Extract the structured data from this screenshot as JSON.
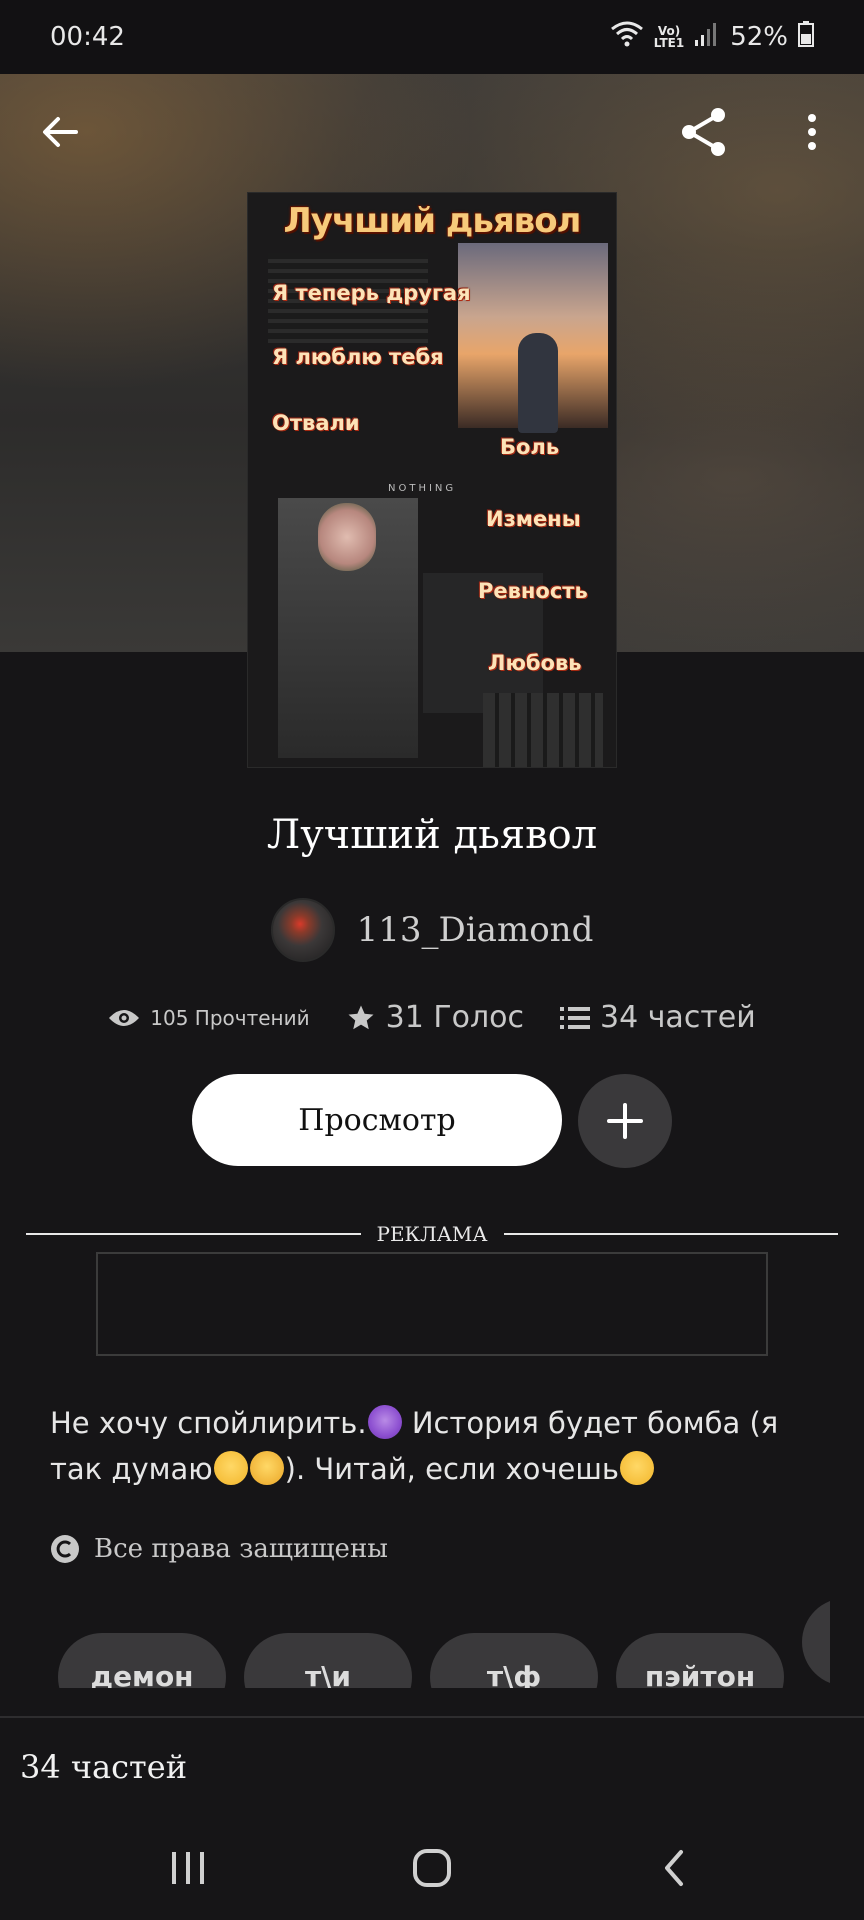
{
  "status_bar": {
    "time": "00:42",
    "lte_top": "Vo)",
    "lte_bottom": "LTE1",
    "battery": "52%"
  },
  "cover": {
    "title": "Лучший дьявол",
    "labels": [
      "Я теперь другая",
      "Я люблю тебя",
      "Отвали",
      "Боль",
      "Измены",
      "Ревность",
      "Любовь"
    ],
    "small_text": "NOTHING"
  },
  "story": {
    "title": "Лучший дьявол",
    "author": "113_Diamond"
  },
  "stats": {
    "reads": "105 Прочтений",
    "votes": "31 Голос",
    "parts": "34 частей"
  },
  "actions": {
    "view_label": "Просмотр"
  },
  "ad": {
    "label": "РЕКЛАМА"
  },
  "description": {
    "part1": "Не хочу спойлирить.",
    "part2": " История будет бомба (я так думаю",
    "part3": "). Читай, если хочешь"
  },
  "copyright": "Все права защищены",
  "tags": [
    "демон",
    "т\\и",
    "т\\ф",
    "пэйтон"
  ],
  "parts_bar": "34 частей"
}
